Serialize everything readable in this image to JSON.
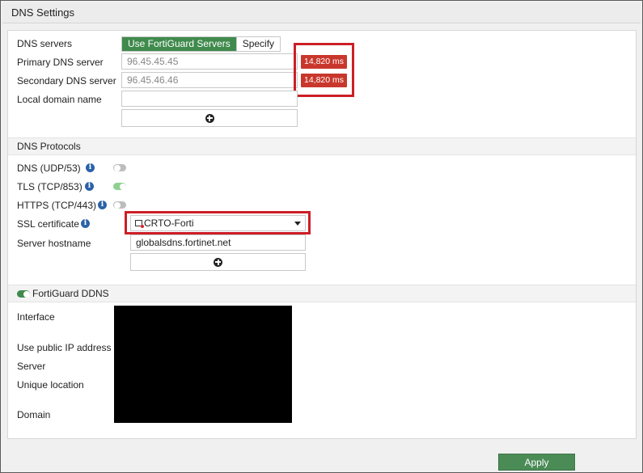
{
  "window": {
    "title": "DNS Settings"
  },
  "dns": {
    "servers_label": "DNS servers",
    "option_fortiguard": "Use FortiGuard Servers",
    "option_specify": "Specify",
    "primary_label": "Primary DNS server",
    "primary_value": "96.45.45.45",
    "primary_latency": "14,820 ms",
    "secondary_label": "Secondary DNS server",
    "secondary_value": "96.45.46.46",
    "secondary_latency": "14,820 ms",
    "local_domain_label": "Local domain name",
    "local_domain_value": ""
  },
  "protocols": {
    "header": "DNS Protocols",
    "udp_label": "DNS (UDP/53)",
    "tls_label": "TLS (TCP/853)",
    "https_label": "HTTPS (TCP/443)",
    "udp_enabled": false,
    "tls_enabled": true,
    "https_enabled": false,
    "ssl_label": "SSL certificate",
    "ssl_value": "CRTO-Forti",
    "hostname_label": "Server hostname",
    "hostname_value": "globalsdns.fortinet.net"
  },
  "ddns": {
    "header": "FortiGuard DDNS",
    "enabled": true,
    "interface_label": "Interface",
    "public_ip_label": "Use public IP address",
    "server_label": "Server",
    "unique_location_label": "Unique location",
    "domain_label": "Domain"
  },
  "footer": {
    "apply_label": "Apply"
  },
  "colors": {
    "accent_green": "#3f8a4c",
    "alert_red": "#c9372c",
    "highlight_red": "#cc1f26",
    "info_blue": "#2b62a8"
  }
}
